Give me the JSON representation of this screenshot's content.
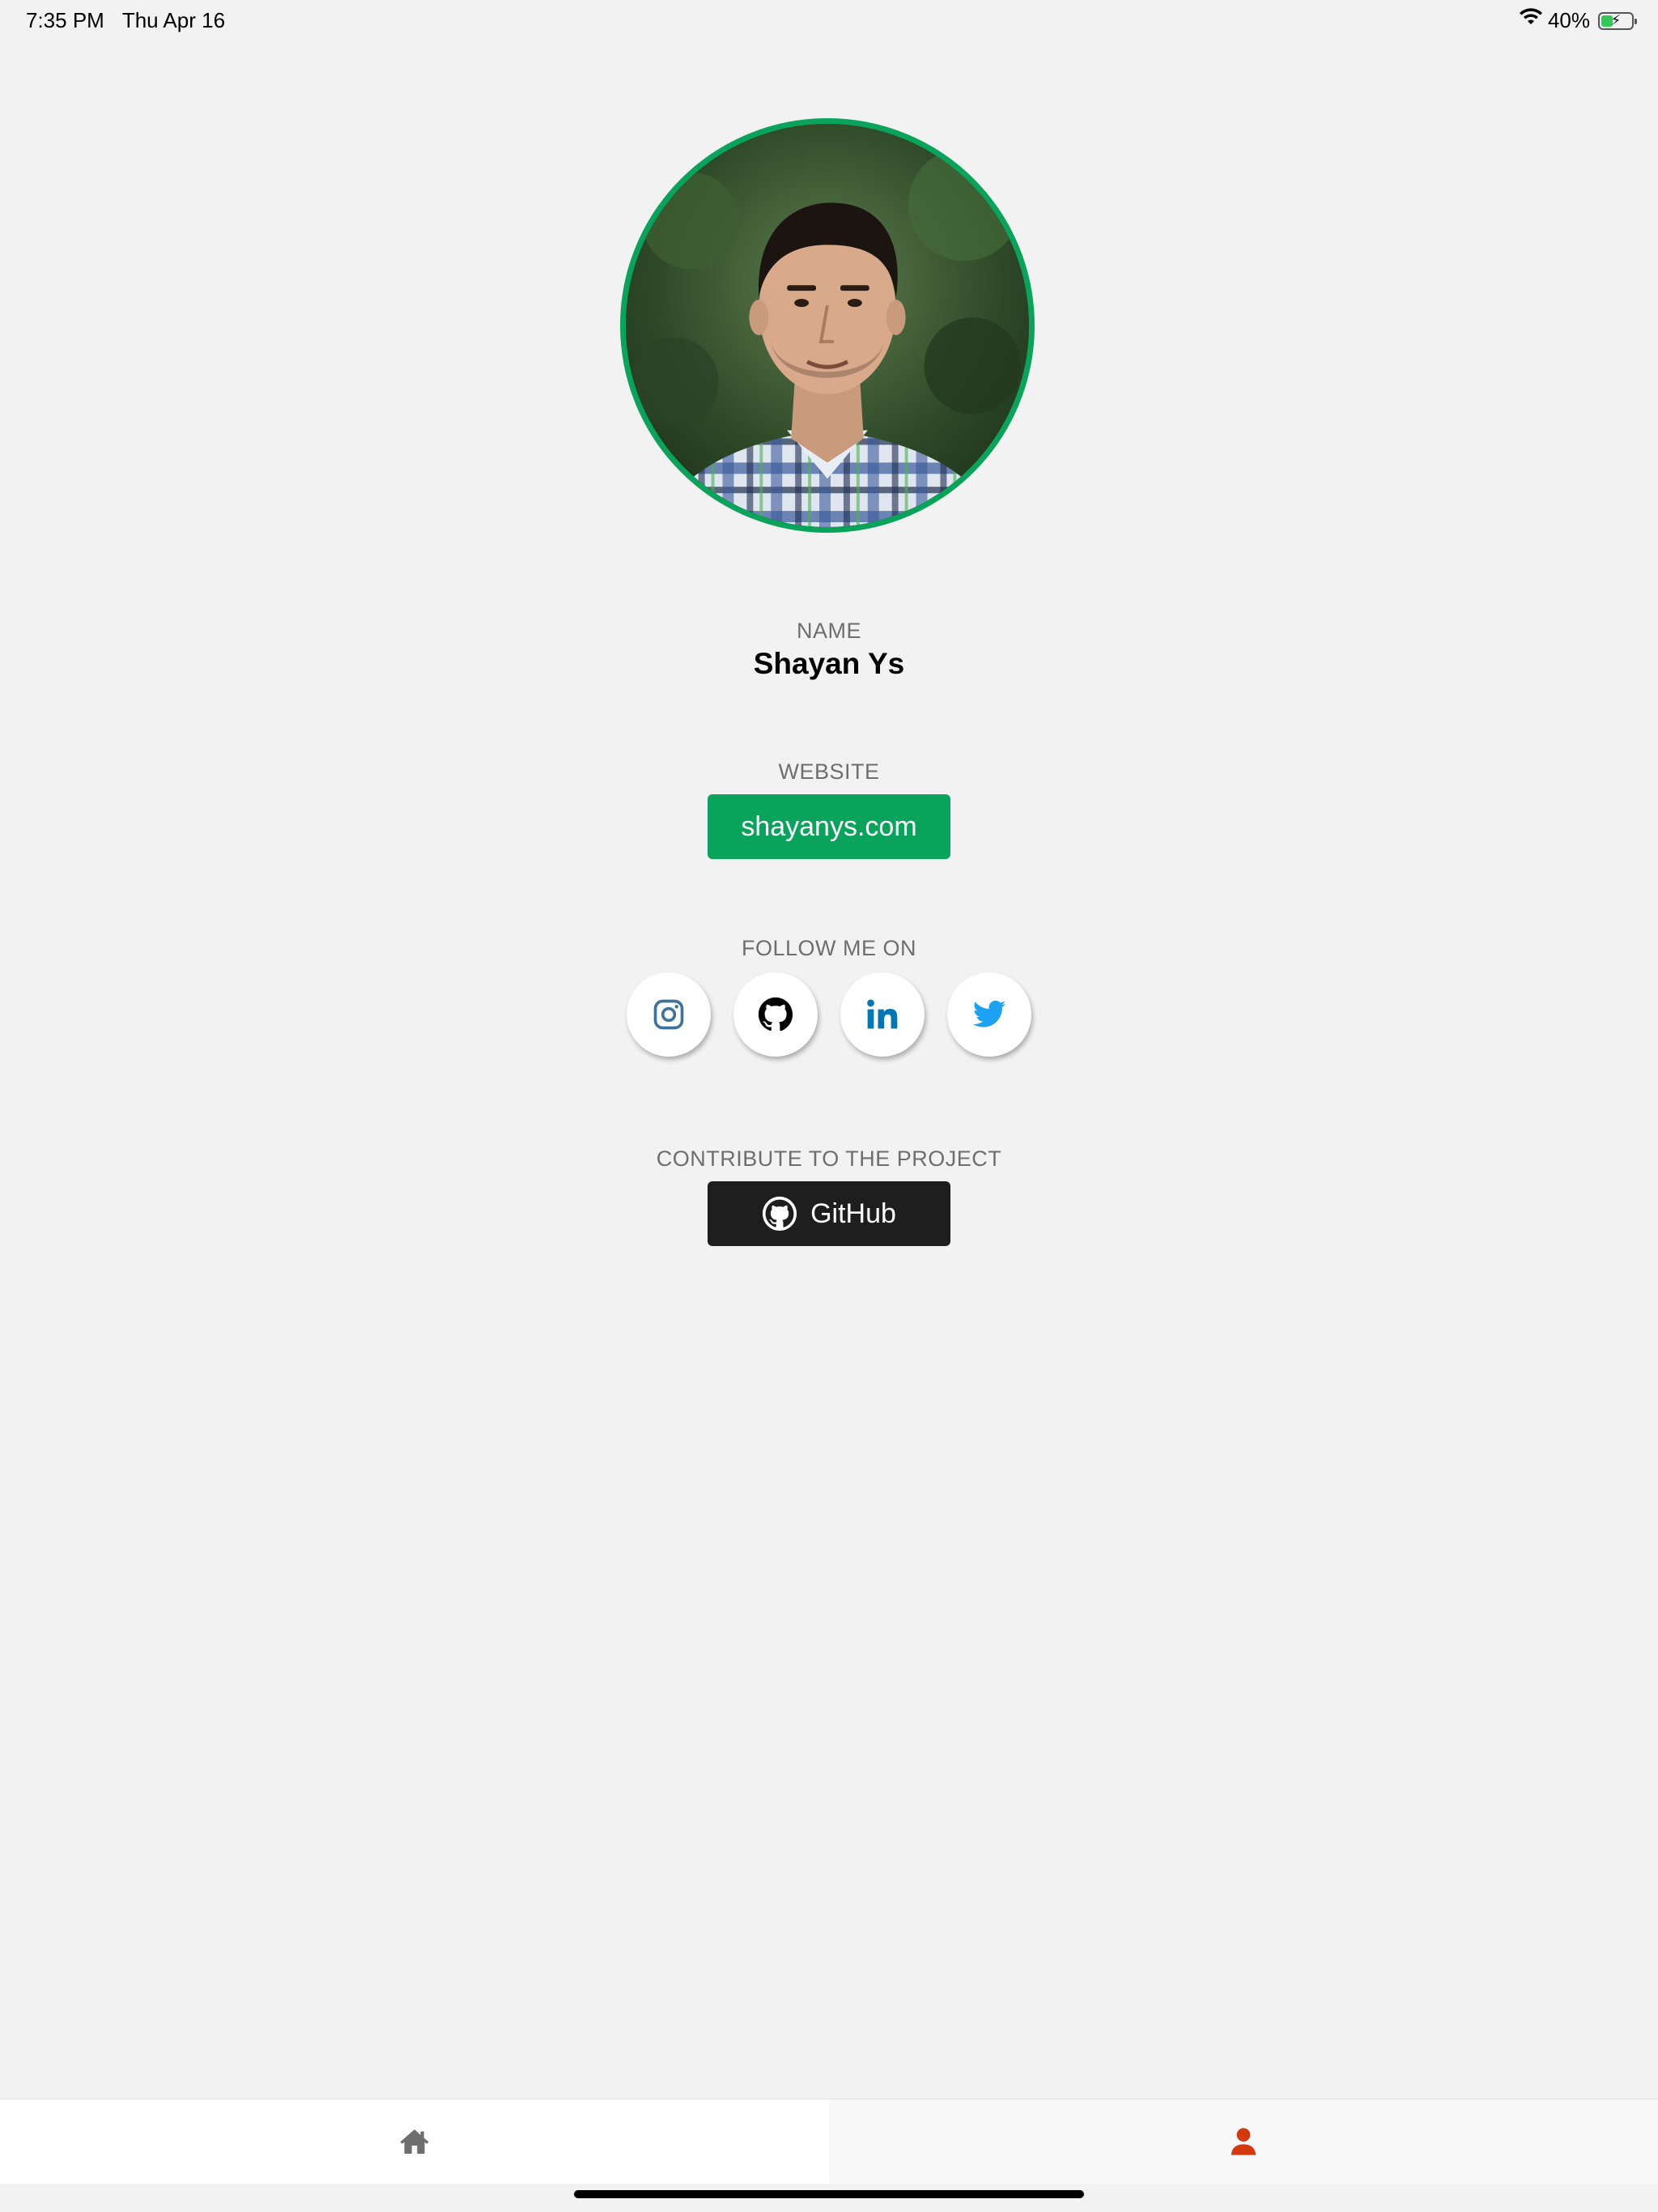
{
  "status_bar": {
    "time": "7:35 PM",
    "date": "Thu Apr 16",
    "battery_percent_text": "40%",
    "battery_level": 0.4
  },
  "profile": {
    "name_label": "NAME",
    "name": "Shayan Ys",
    "website_label": "WEBSITE",
    "website": "shayanys.com",
    "follow_label": "FOLLOW ME ON",
    "social": [
      {
        "icon": "instagram-icon",
        "color": "#3f729b"
      },
      {
        "icon": "github-icon",
        "color": "#000000"
      },
      {
        "icon": "linkedin-icon",
        "color": "#0077b5"
      },
      {
        "icon": "twitter-icon",
        "color": "#1da1f2"
      }
    ],
    "contribute_label": "CONTRIBUTE TO THE PROJECT",
    "github_button": "GitHub"
  },
  "colors": {
    "accent_green": "#0aa35b",
    "active_tab": "#d4380d",
    "inactive_tab": "#6e6e6e",
    "dark_button": "#1e1e1e"
  },
  "tabs": [
    {
      "icon": "home-icon",
      "active": false
    },
    {
      "icon": "user-icon",
      "active": true
    }
  ]
}
